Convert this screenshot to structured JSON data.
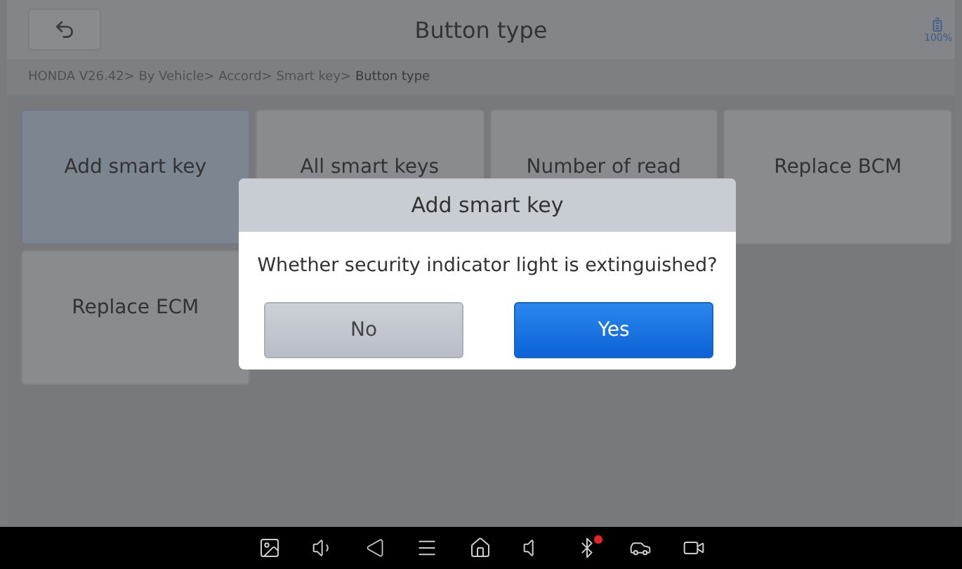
{
  "header": {
    "title": "Button type",
    "battery": "100%"
  },
  "breadcrumb": {
    "path": "HONDA V26.42> By Vehicle> Accord> Smart key> ",
    "current": "Button type"
  },
  "tiles": [
    {
      "label": "Add smart key",
      "selected": true
    },
    {
      "label": "All smart keys",
      "selected": false
    },
    {
      "label": "Number of read",
      "selected": false
    },
    {
      "label": "Replace BCM",
      "selected": false
    },
    {
      "label": "Replace ECM",
      "selected": false
    }
  ],
  "dialog": {
    "title": "Add smart key",
    "message": "Whether security indicator light is extinguished?",
    "buttons": [
      {
        "label": "No",
        "kind": "secondary"
      },
      {
        "label": "Yes",
        "kind": "primary"
      }
    ]
  },
  "navbar": {
    "bluetooth_alert": true
  }
}
